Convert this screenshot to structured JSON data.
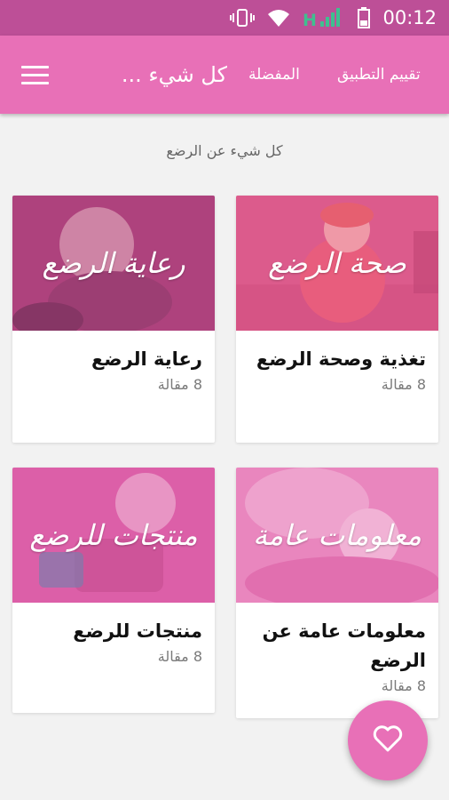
{
  "status_bar": {
    "time": "00:12",
    "network_label": "H",
    "icons": [
      "vibrate-icon",
      "wifi-icon",
      "signal-icon",
      "battery-icon"
    ]
  },
  "app_bar": {
    "title": "كل شيء ...",
    "actions": {
      "favorites": "المفضلة",
      "rate": "تقييم التطبيق"
    },
    "menu_icon": "menu-icon"
  },
  "section_title": "كل شيء عن الرضع",
  "cards": [
    {
      "thumb_text": "صحة الرضع",
      "title": "تغذية وصحة الرضع",
      "count": "8 مقالة"
    },
    {
      "thumb_text": "رعاية الرضع",
      "title": "رعاية الرضع",
      "count": "8 مقالة"
    },
    {
      "thumb_text": "معلومات عامة",
      "title": "معلومات عامة عن الرضع",
      "count": "8 مقالة"
    },
    {
      "thumb_text": "منتجات للرضع",
      "title": "منتجات للرضع",
      "count": "8 مقالة"
    }
  ],
  "fab": {
    "icon": "heart-icon"
  },
  "colors": {
    "status_bar": "#bd4f97",
    "app_bar": "#e870b7",
    "accent": "#e870b7",
    "background": "#f2f2f2"
  }
}
